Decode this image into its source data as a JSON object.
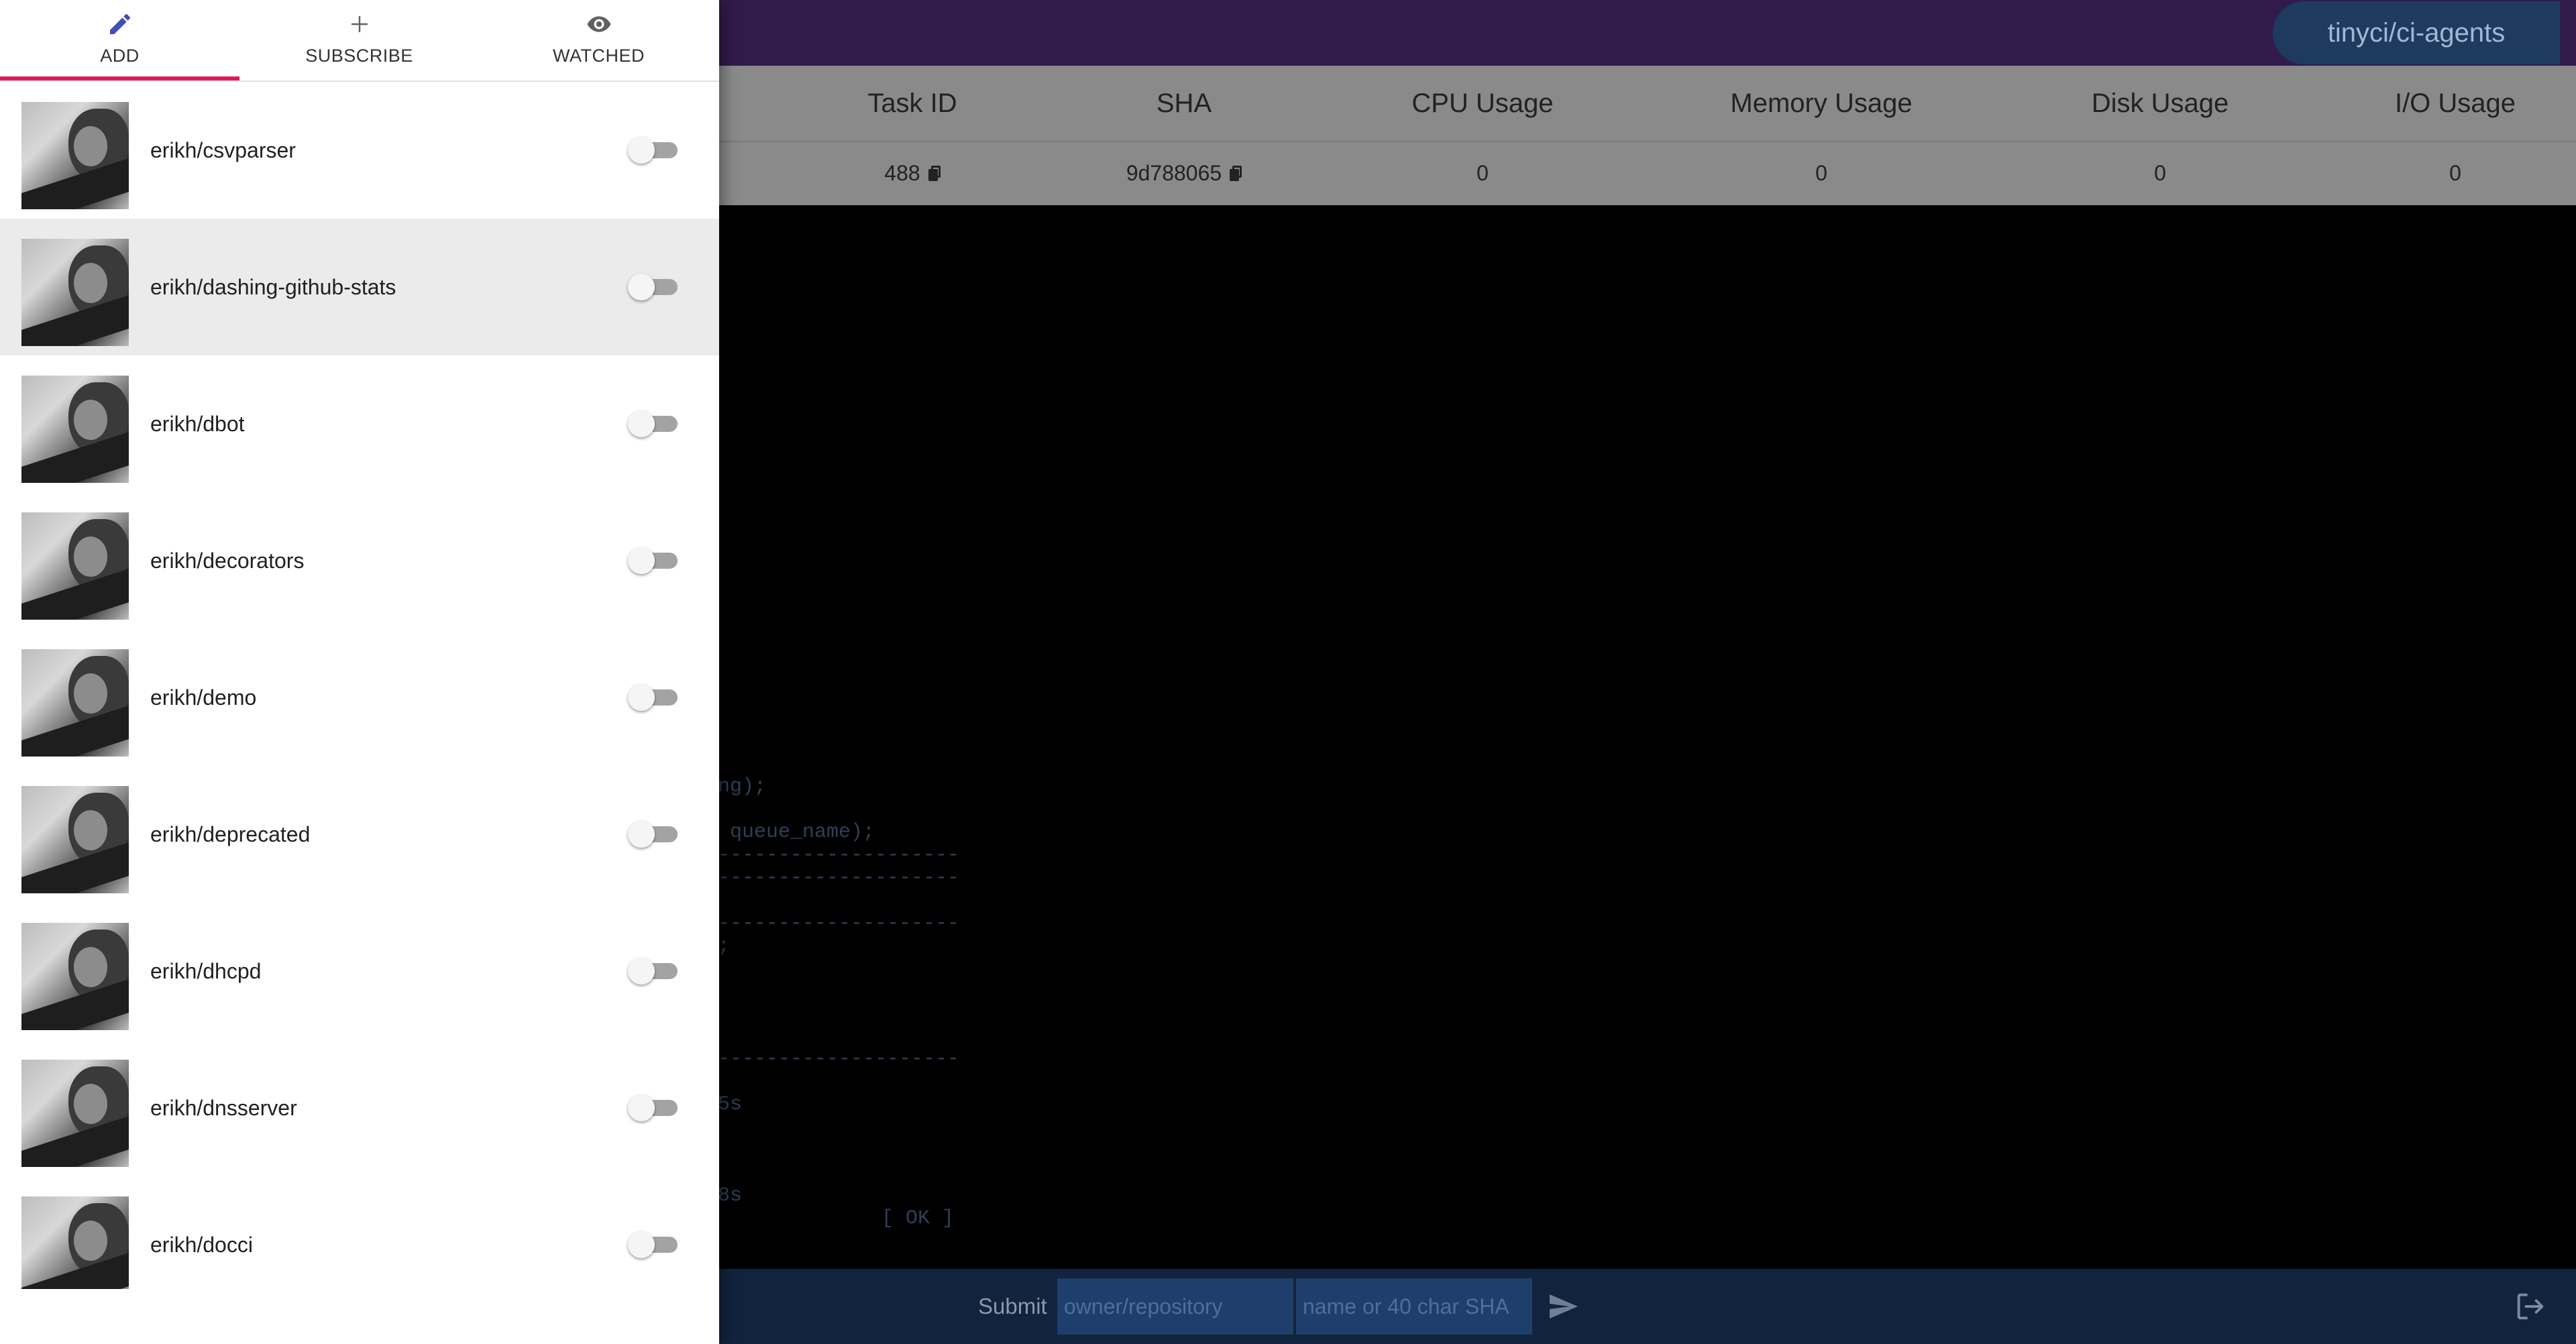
{
  "header": {
    "repo_chip": "tinyci/ci-agents"
  },
  "table": {
    "columns": [
      "Task ID",
      "SHA",
      "CPU Usage",
      "Memory Usage",
      "Disk Usage",
      "I/O Usage"
    ],
    "row": [
      "488",
      "9d788065",
      "0",
      "0",
      "0",
      "0"
    ]
  },
  "terminal": {
    "lines": [
      "ng);",
      " queue_name);",
      "--------------------",
      "--------------------",
      "--------------------",
      ";",
      "--------------------",
      "5s",
      "8s",
      "[ OK ]"
    ]
  },
  "bottombar": {
    "submit_label": "Submit",
    "repo_placeholder": "owner/repository",
    "ref_placeholder": "name or 40 char SHA"
  },
  "drawer": {
    "tabs": [
      {
        "label": "ADD",
        "icon": "pencil-icon",
        "active": true
      },
      {
        "label": "SUBSCRIBE",
        "icon": "plus-icon",
        "active": false
      },
      {
        "label": "WATCHED",
        "icon": "eye-icon",
        "active": false
      }
    ],
    "repos": [
      {
        "name": "erikh/csvparser",
        "enabled": false
      },
      {
        "name": "erikh/dashing-github-stats",
        "enabled": false
      },
      {
        "name": "erikh/dbot",
        "enabled": false
      },
      {
        "name": "erikh/decorators",
        "enabled": false
      },
      {
        "name": "erikh/demo",
        "enabled": false
      },
      {
        "name": "erikh/deprecated",
        "enabled": false
      },
      {
        "name": "erikh/dhcpd",
        "enabled": false
      },
      {
        "name": "erikh/dnsserver",
        "enabled": false
      },
      {
        "name": "erikh/docci",
        "enabled": false
      }
    ]
  },
  "colors": {
    "topbar": "#311b4a",
    "tab_indicator": "#d81b60",
    "active_icon": "#3f51b5",
    "bottombar": "#12233d"
  }
}
